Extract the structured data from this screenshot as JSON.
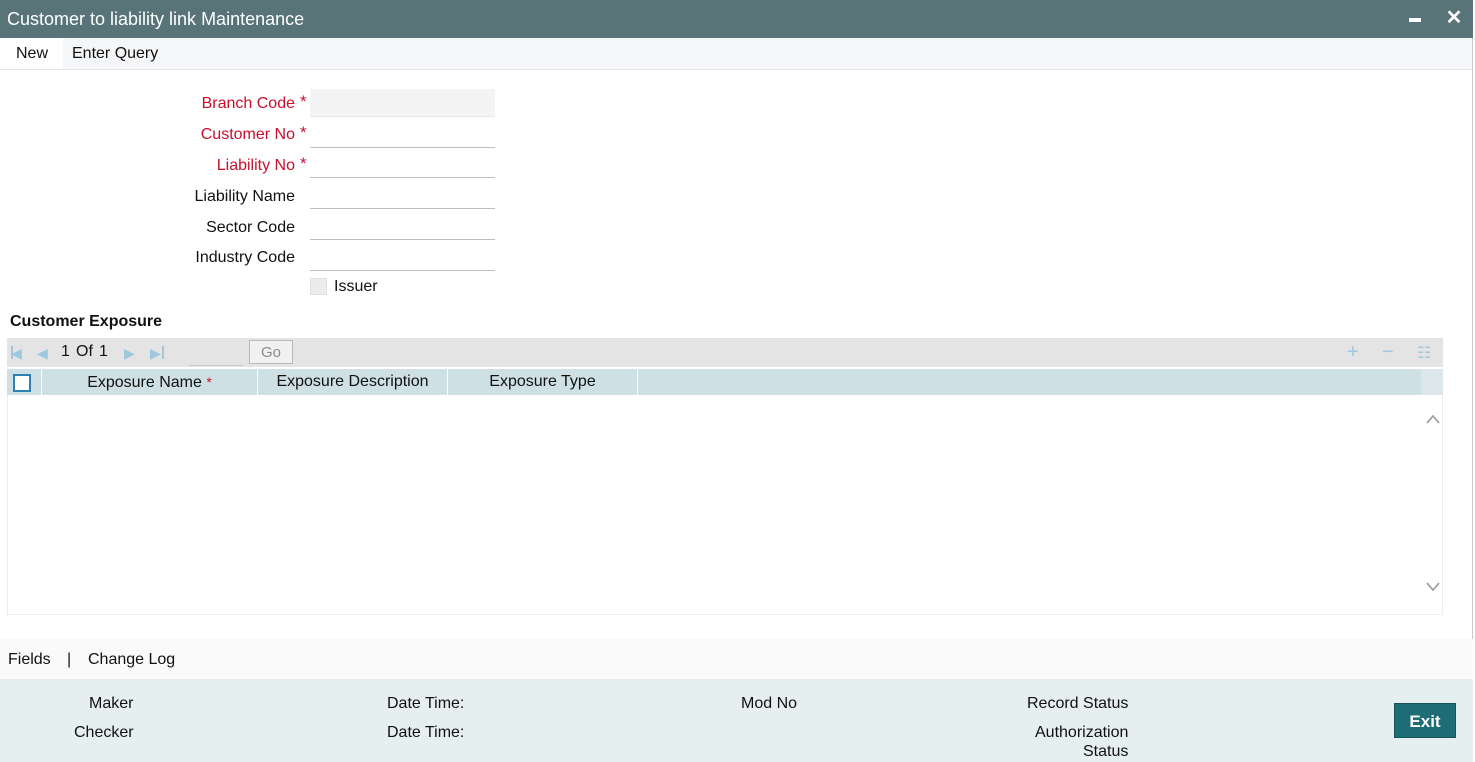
{
  "window": {
    "title": "Customer to liability link Maintenance"
  },
  "menu": {
    "new": "New",
    "enter_query": "Enter Query"
  },
  "form": {
    "branch_code": {
      "label": "Branch Code",
      "value": ""
    },
    "customer_no": {
      "label": "Customer No",
      "value": ""
    },
    "liability_no": {
      "label": "Liability No",
      "value": ""
    },
    "liability_name": {
      "label": "Liability Name",
      "value": ""
    },
    "sector_code": {
      "label": "Sector Code",
      "value": ""
    },
    "industry_code": {
      "label": "Industry Code",
      "value": ""
    },
    "issuer": {
      "label": "Issuer",
      "checked": false
    },
    "required_marker": "*"
  },
  "exposure": {
    "title": "Customer Exposure",
    "pager": {
      "current": "1",
      "of": "Of",
      "total": "1",
      "go": "Go"
    },
    "columns": [
      "Exposure Name",
      "Exposure Description",
      "Exposure Type"
    ],
    "rows": []
  },
  "footer": {
    "fields": "Fields",
    "separator": "|",
    "change_log": "Change Log"
  },
  "audit": {
    "maker": "Maker",
    "checker": "Checker",
    "date_time_1": "Date Time:",
    "date_time_2": "Date Time:",
    "mod_no": "Mod No",
    "record_status": "Record Status",
    "authorization": "Authorization",
    "status": "Status",
    "exit": "Exit"
  },
  "colors": {
    "titlebar": "#587479",
    "required": "#c8102e",
    "exit": "#1e6c76",
    "grid_header": "#cfe0e5"
  }
}
